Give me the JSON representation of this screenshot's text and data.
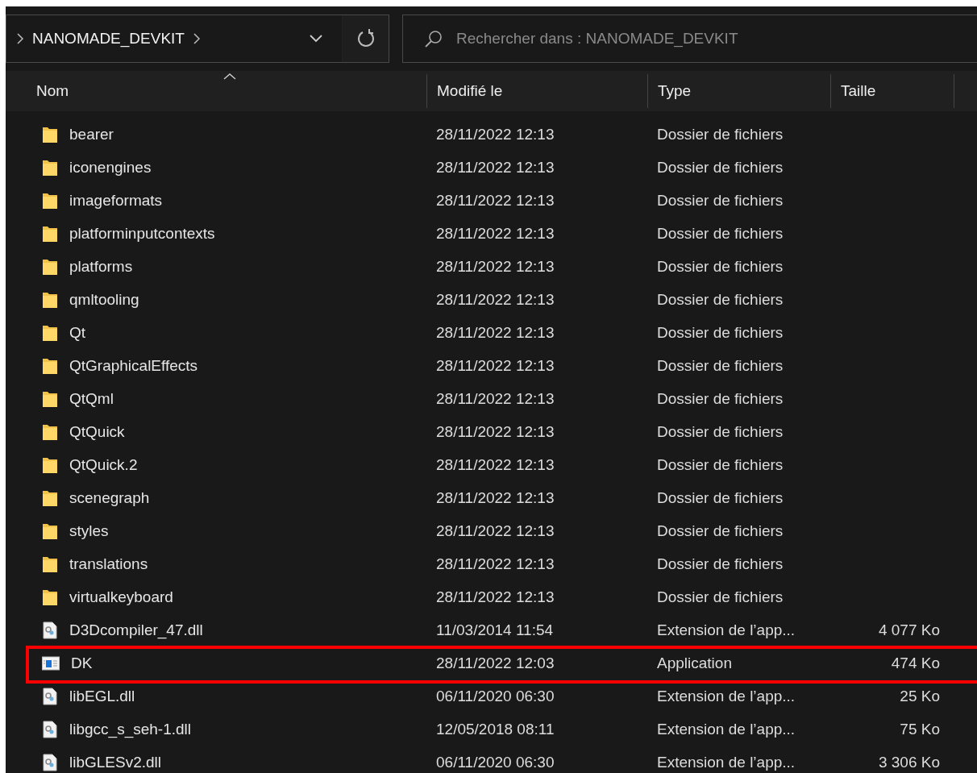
{
  "address_bar": {
    "path": "NANOMADE_DEVKIT"
  },
  "search": {
    "placeholder": "Rechercher dans : NANOMADE_DEVKIT"
  },
  "table": {
    "columns": [
      {
        "label": "Nom",
        "sorted": true
      },
      {
        "label": "Modifié le",
        "sorted": false
      },
      {
        "label": "Type",
        "sorted": false
      },
      {
        "label": "Taille",
        "sorted": false
      }
    ],
    "rows": [
      {
        "kind": "folder",
        "name": "bearer",
        "modified": "28/11/2022 12:13",
        "type": "Dossier de fichiers",
        "highlighted": false
      },
      {
        "kind": "folder",
        "name": "iconengines",
        "modified": "28/11/2022 12:13",
        "type": "Dossier de fichiers",
        "highlighted": false
      },
      {
        "kind": "folder",
        "name": "imageformats",
        "modified": "28/11/2022 12:13",
        "type": "Dossier de fichiers",
        "highlighted": false
      },
      {
        "kind": "folder",
        "name": "platforminputcontexts",
        "modified": "28/11/2022 12:13",
        "type": "Dossier de fichiers",
        "highlighted": false
      },
      {
        "kind": "folder",
        "name": "platforms",
        "modified": "28/11/2022 12:13",
        "type": "Dossier de fichiers",
        "highlighted": false
      },
      {
        "kind": "folder",
        "name": "qmltooling",
        "modified": "28/11/2022 12:13",
        "type": "Dossier de fichiers",
        "highlighted": false
      },
      {
        "kind": "folder",
        "name": "Qt",
        "modified": "28/11/2022 12:13",
        "type": "Dossier de fichiers",
        "highlighted": false
      },
      {
        "kind": "folder",
        "name": "QtGraphicalEffects",
        "modified": "28/11/2022 12:13",
        "type": "Dossier de fichiers",
        "highlighted": false
      },
      {
        "kind": "folder",
        "name": "QtQml",
        "modified": "28/11/2022 12:13",
        "type": "Dossier de fichiers",
        "highlighted": false
      },
      {
        "kind": "folder",
        "name": "QtQuick",
        "modified": "28/11/2022 12:13",
        "type": "Dossier de fichiers",
        "highlighted": false
      },
      {
        "kind": "folder",
        "name": "QtQuick.2",
        "modified": "28/11/2022 12:13",
        "type": "Dossier de fichiers",
        "highlighted": false
      },
      {
        "kind": "folder",
        "name": "scenegraph",
        "modified": "28/11/2022 12:13",
        "type": "Dossier de fichiers",
        "highlighted": false
      },
      {
        "kind": "folder",
        "name": "styles",
        "modified": "28/11/2022 12:13",
        "type": "Dossier de fichiers",
        "highlighted": false
      },
      {
        "kind": "folder",
        "name": "translations",
        "modified": "28/11/2022 12:13",
        "type": "Dossier de fichiers",
        "highlighted": false
      },
      {
        "kind": "folder",
        "name": "virtualkeyboard",
        "modified": "28/11/2022 12:13",
        "type": "Dossier de fichiers",
        "highlighted": false
      },
      {
        "kind": "dll",
        "name": "D3Dcompiler_47.dll",
        "modified": "11/03/2014 11:54",
        "type": "Extension de l’app...",
        "size": "4 077 Ko",
        "highlighted": false
      },
      {
        "kind": "app",
        "name": "DK",
        "modified": "28/11/2022 12:03",
        "type": "Application",
        "size": "474 Ko",
        "highlighted": true
      },
      {
        "kind": "dll",
        "name": "libEGL.dll",
        "modified": "06/11/2020 06:30",
        "type": "Extension de l’app...",
        "size": "25 Ko",
        "highlighted": false
      },
      {
        "kind": "dll",
        "name": "libgcc_s_seh-1.dll",
        "modified": "12/05/2018 08:11",
        "type": "Extension de l’app...",
        "size": "75 Ko",
        "highlighted": false
      },
      {
        "kind": "dll",
        "name": "libGLESv2.dll",
        "modified": "06/11/2020 06:30",
        "type": "Extension de l’app...",
        "size": "3 306 Ko",
        "highlighted": false
      }
    ]
  }
}
